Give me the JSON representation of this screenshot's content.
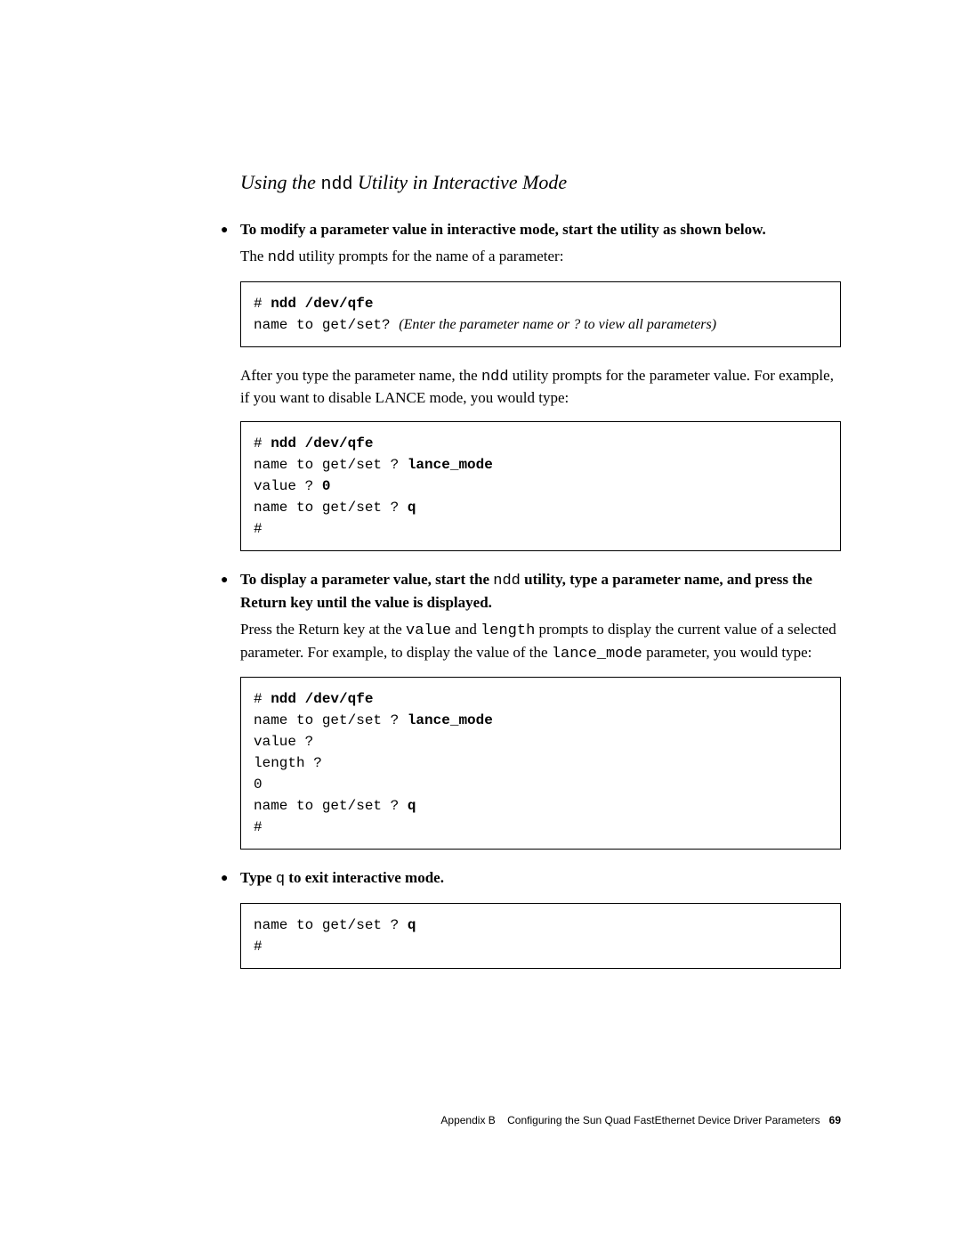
{
  "heading": {
    "pre": "Using the ",
    "code": "ndd",
    "post": " Utility in Interactive Mode"
  },
  "section1": {
    "lead": "To modify a parameter value in interactive mode, start the utility as shown below.",
    "para1_pre": "The ",
    "para1_code": "ndd",
    "para1_post": " utility prompts for the name of a parameter:",
    "codebox1": {
      "l1_prompt": "# ",
      "l1_cmd": "ndd /dev/qfe",
      "l2_text": "name to get/set? ",
      "l2_italic": "(Enter the parameter name or ",
      "l2_q": "?",
      "l2_italic_end": " to view all parameters)"
    },
    "para2_pre": "After you type the parameter name, the ",
    "para2_code": "ndd",
    "para2_post": " utility prompts for the parameter value. For example, if you want to disable LANCE mode, you would type:",
    "codebox2": {
      "l1_prompt": "# ",
      "l1_cmd": "ndd /dev/qfe",
      "l2_text": "name to get/set ? ",
      "l2_input": "lance_mode",
      "l3_text": "value ? ",
      "l3_input": "0",
      "l4_text": "name to get/set ? ",
      "l4_input": "q",
      "l5_text": "#"
    }
  },
  "section2": {
    "lead_pre": "To display a parameter value, start the ",
    "lead_code": "ndd",
    "lead_post": " utility, type a parameter name, and press the Return key until the value is displayed.",
    "para1_pre": "Press the Return key at the ",
    "para1_code1": "value",
    "para1_mid": " and ",
    "para1_code2": "length",
    "para1_text2": " prompts to display the current value of a selected parameter. For example, to display the value of the ",
    "para1_code3": "lance_mode",
    "para1_end": " parameter, you would type:",
    "codebox1": {
      "l1_prompt": "# ",
      "l1_cmd": "ndd /dev/qfe",
      "l2_text": "name to get/set ? ",
      "l2_input": "lance_mode",
      "l3_text": "value ?",
      "l4_text": "length ?",
      "l5_text": "0",
      "l6_text": "name to get/set ? ",
      "l6_input": "q",
      "l7_text": "#"
    }
  },
  "section3": {
    "lead_pre": "Type ",
    "lead_code": "q",
    "lead_post": " to exit interactive mode.",
    "codebox1": {
      "l1_text": "name to get/set ? ",
      "l1_input": "q",
      "l2_text": "#"
    }
  },
  "footer": {
    "appendix": "Appendix B",
    "title": "Configuring the Sun Quad FastEthernet Device Driver Parameters",
    "pageno": "69"
  }
}
